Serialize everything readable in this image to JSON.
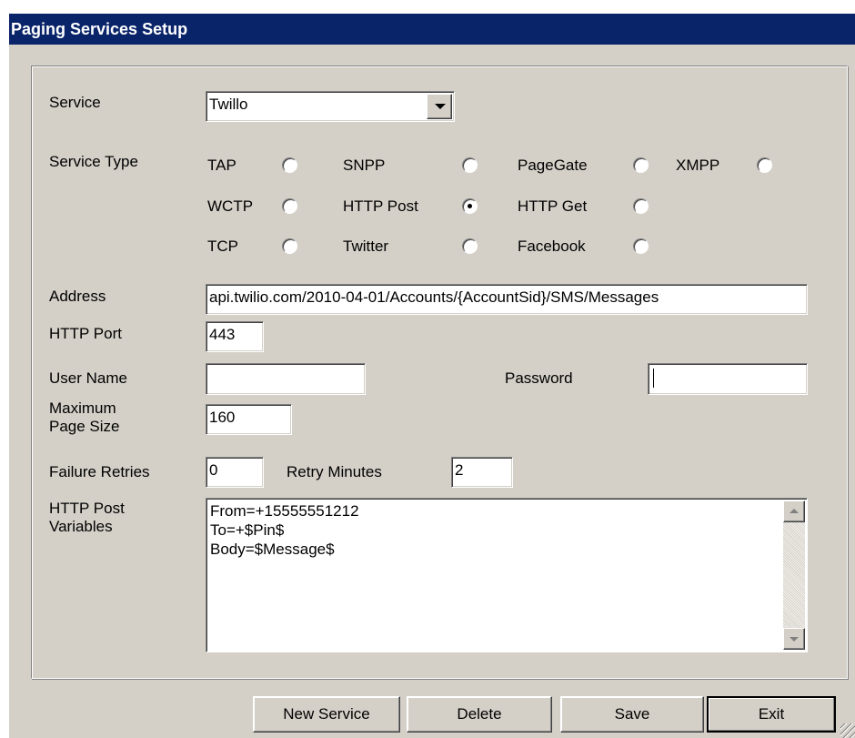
{
  "window": {
    "title": "Paging Services Setup"
  },
  "service": {
    "label": "Service",
    "selected": "Twillo"
  },
  "service_type": {
    "label": "Service Type",
    "options": [
      {
        "label": "TAP",
        "checked": false
      },
      {
        "label": "SNPP",
        "checked": false
      },
      {
        "label": "PageGate",
        "checked": false
      },
      {
        "label": "XMPP",
        "checked": false
      },
      {
        "label": "WCTP",
        "checked": false
      },
      {
        "label": "HTTP Post",
        "checked": true
      },
      {
        "label": "HTTP Get",
        "checked": false
      },
      {
        "label": "TCP",
        "checked": false
      },
      {
        "label": "Twitter",
        "checked": false
      },
      {
        "label": "Facebook",
        "checked": false
      }
    ]
  },
  "address": {
    "label": "Address",
    "value": "api.twilio.com/2010-04-01/Accounts/{AccountSid}/SMS/Messages"
  },
  "http_port": {
    "label": "HTTP Port",
    "value": "443"
  },
  "user_name": {
    "label": "User Name",
    "value": ""
  },
  "password": {
    "label": "Password",
    "value": ""
  },
  "max_page_size": {
    "label_line1": "Maximum",
    "label_line2": "Page Size",
    "value": "160"
  },
  "failure_retries": {
    "label": "Failure Retries",
    "value": "0"
  },
  "retry_minutes": {
    "label": "Retry Minutes",
    "value": "2"
  },
  "post_variables": {
    "label_line1": "HTTP Post",
    "label_line2": "Variables",
    "lines": [
      "From=+15555551212",
      "To=+$Pin$",
      "Body=$Message$"
    ]
  },
  "buttons": {
    "new_service": "New Service",
    "delete": "Delete",
    "save": "Save",
    "exit": "Exit"
  },
  "colors": {
    "titlebar": "#0a246a",
    "face": "#d4d0c8"
  }
}
